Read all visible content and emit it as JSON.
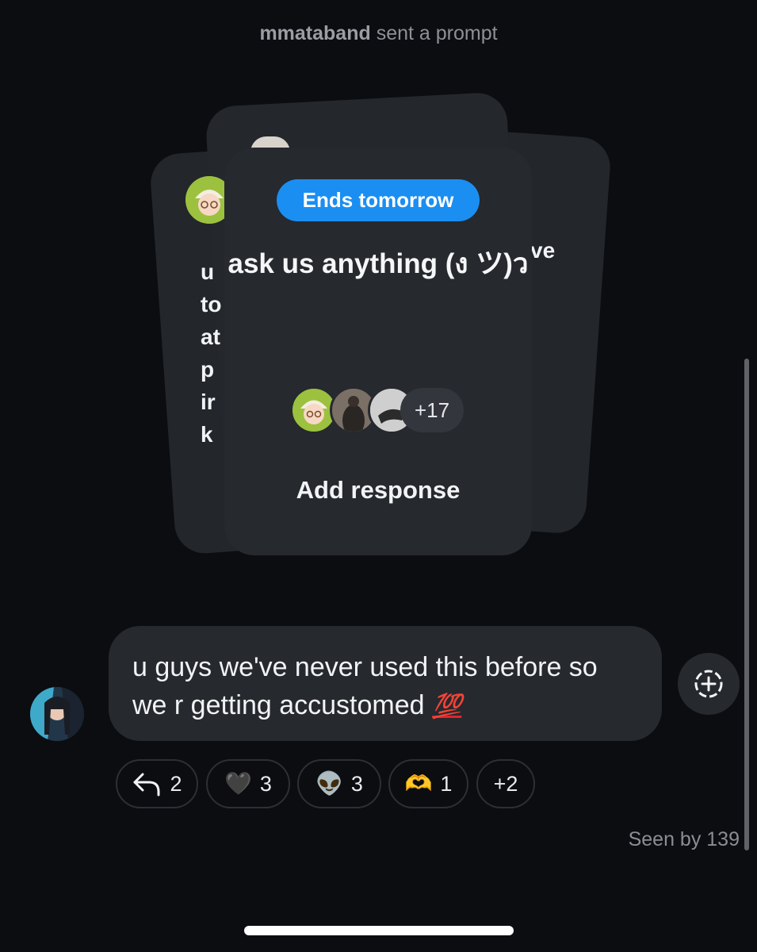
{
  "system": {
    "sender": "mmataband",
    "action": "sent a prompt"
  },
  "prompt_card": {
    "badge": "Ends tomorrow",
    "title": "ask us anything (ง ツ)ว",
    "more_count": "+17",
    "add_response": "Add response",
    "back_left_text": [
      "u",
      "to",
      "at",
      "p",
      "ir",
      "k"
    ],
    "back_right_text": "ve"
  },
  "message": {
    "text": "u guys we've never used this before so we r getting accustomed",
    "emoji": "💯"
  },
  "reactions": [
    {
      "icon": "reply-arrow-icon",
      "count": "2"
    },
    {
      "icon": "black-heart",
      "emoji": "🖤",
      "count": "3"
    },
    {
      "icon": "alien",
      "emoji": "👽",
      "count": "3"
    },
    {
      "icon": "heart-hands",
      "emoji": "🫶",
      "count": "1"
    },
    {
      "label": "+2"
    }
  ],
  "seen": "Seen by 139",
  "colors": {
    "accent": "#1b8ef2",
    "background": "#0b0d11",
    "bubble": "#26292e"
  }
}
